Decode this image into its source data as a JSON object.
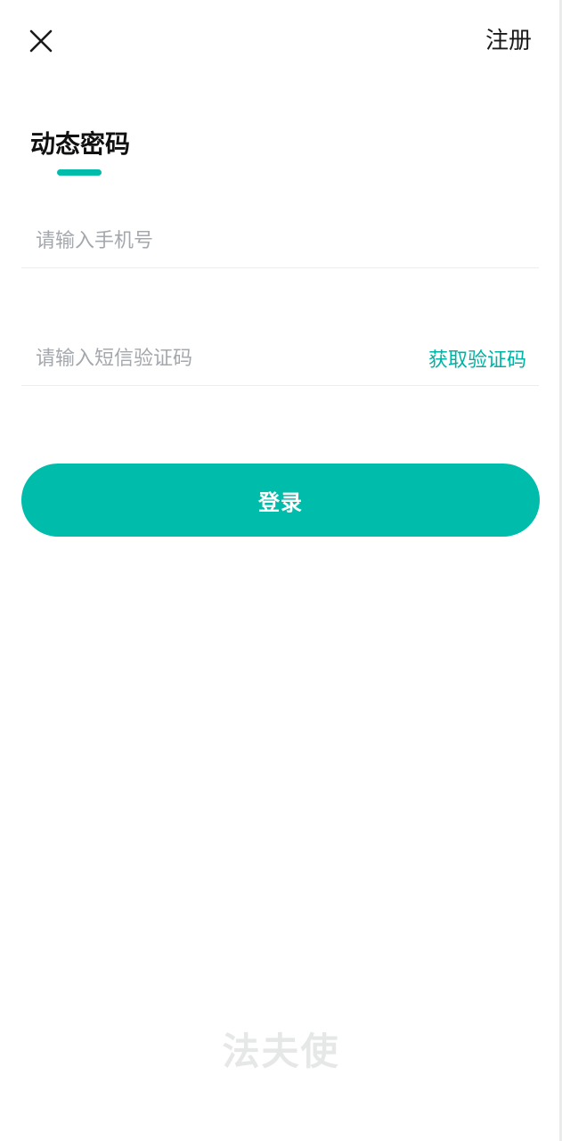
{
  "header": {
    "close_icon": "close-icon",
    "register_label": "注册"
  },
  "tab": {
    "title": "动态密码"
  },
  "form": {
    "phone_placeholder": "请输入手机号",
    "sms_placeholder": "请输入短信验证码",
    "get_code_label": "获取验证码"
  },
  "login": {
    "label": "登录"
  },
  "footer": {
    "logo_text": "法夫使"
  },
  "colors": {
    "accent": "#00bcab",
    "link": "#00b2a3",
    "placeholder": "#a4a8ad",
    "divider": "#eceeee"
  }
}
